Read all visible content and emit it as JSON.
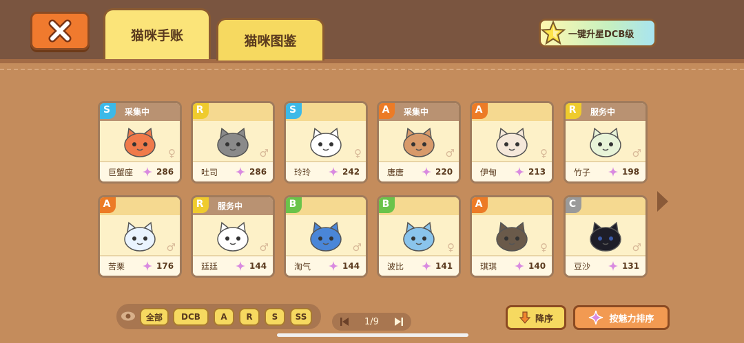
{
  "tabs": [
    {
      "label": "猫咪手账",
      "active": true
    },
    {
      "label": "猫咪图鉴",
      "active": false
    }
  ],
  "upgrade_button": {
    "label": "一键升星DCB级"
  },
  "colors": {
    "rank_S": "#3cb9e8",
    "rank_R": "#efcb2d",
    "rank_A": "#ec7b26",
    "rank_B": "#6ac34a",
    "rank_C": "#9a9a9a"
  },
  "cats": [
    {
      "rank": "S",
      "status": "采集中",
      "name": "巨蟹座",
      "charm": "286",
      "gender": "♀",
      "icon": "crab-cat-icon"
    },
    {
      "rank": "R",
      "status": "",
      "name": "吐司",
      "charm": "286",
      "gender": "♂",
      "icon": "gray-cat-icon"
    },
    {
      "rank": "S",
      "status": "",
      "name": "玲玲",
      "charm": "242",
      "gender": "♀",
      "icon": "sailor-cat-icon"
    },
    {
      "rank": "A",
      "status": "采集中",
      "name": "唐唐",
      "charm": "220",
      "gender": "♂",
      "icon": "glasses-cat-icon"
    },
    {
      "rank": "A",
      "status": "",
      "name": "伊甸",
      "charm": "213",
      "gender": "♀",
      "icon": "hair-cat-icon"
    },
    {
      "rank": "R",
      "status": "服务中",
      "name": "竹子",
      "charm": "198",
      "gender": "♂",
      "icon": "bamboo-cat-icon"
    },
    {
      "rank": "A",
      "status": "",
      "name": "苦栗",
      "charm": "176",
      "gender": "♂",
      "icon": "helmet-cat-icon"
    },
    {
      "rank": "R",
      "status": "服务中",
      "name": "廷廷",
      "charm": "144",
      "gender": "♂",
      "icon": "white-cat-icon"
    },
    {
      "rank": "B",
      "status": "",
      "name": "淘气",
      "charm": "144",
      "gender": "♂",
      "icon": "blue-cat-icon"
    },
    {
      "rank": "B",
      "status": "",
      "name": "波比",
      "charm": "141",
      "gender": "♀",
      "icon": "lightblue-cat-icon"
    },
    {
      "rank": "A",
      "status": "",
      "name": "琪琪",
      "charm": "140",
      "gender": "♀",
      "icon": "police-cat-icon"
    },
    {
      "rank": "C",
      "status": "",
      "name": "豆沙",
      "charm": "131",
      "gender": "♂",
      "icon": "black-cat-icon"
    }
  ],
  "filters": [
    "全部",
    "DCB",
    "A",
    "R",
    "S",
    "SS"
  ],
  "pager": {
    "text": "1/9"
  },
  "sort": {
    "desc_label": "降序",
    "charm_label": "按魅力排序"
  }
}
